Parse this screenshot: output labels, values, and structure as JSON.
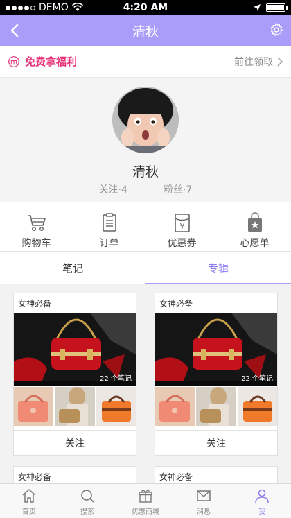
{
  "status_bar": {
    "carrier": "DEMO",
    "time": "4:20 AM"
  },
  "nav": {
    "title": "清秋"
  },
  "promo": {
    "title": "免费拿福利",
    "link": "前往领取"
  },
  "profile": {
    "name": "清秋",
    "following": "关注·4",
    "followers": "粉丝·7"
  },
  "shortcuts": [
    {
      "label": "购物车",
      "icon": "cart-icon"
    },
    {
      "label": "订单",
      "icon": "order-icon"
    },
    {
      "label": "优惠券",
      "icon": "coupon-icon"
    },
    {
      "label": "心愿单",
      "icon": "wishlist-icon"
    }
  ],
  "tabs": [
    {
      "label": "笔记",
      "active": false
    },
    {
      "label": "专辑",
      "active": true
    }
  ],
  "albums": [
    {
      "title": "女神必备",
      "count": "22 个笔记",
      "follow": "关注"
    },
    {
      "title": "女神必备",
      "count": "22 个笔记",
      "follow": "关注"
    },
    {
      "title": "女神必备"
    },
    {
      "title": "女神必备"
    }
  ],
  "tabbar": [
    {
      "label": "首页",
      "icon": "home-icon",
      "active": false
    },
    {
      "label": "搜索",
      "icon": "search-icon",
      "active": false
    },
    {
      "label": "优惠商城",
      "icon": "gift-icon",
      "active": false
    },
    {
      "label": "消息",
      "icon": "mail-icon",
      "active": false
    },
    {
      "label": "我",
      "icon": "user-icon",
      "active": true
    }
  ],
  "colors": {
    "accent": "#a99df9",
    "promo": "#e7337a",
    "active_text": "#8a7df0"
  }
}
